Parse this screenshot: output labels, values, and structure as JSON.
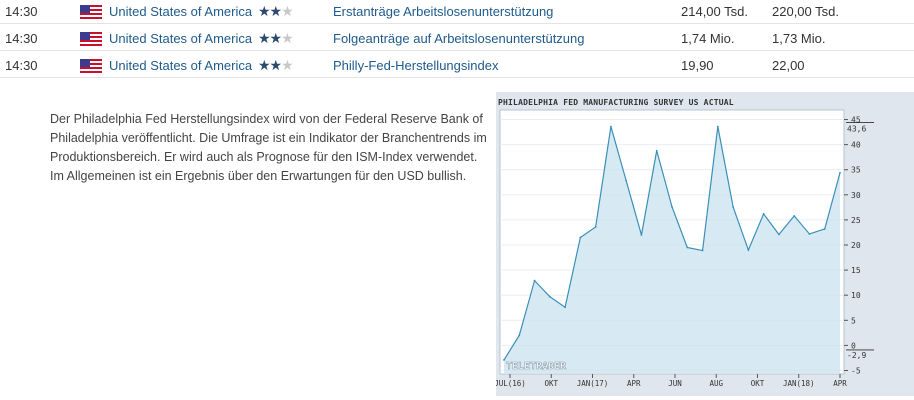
{
  "rows": [
    {
      "time": "14:30",
      "country": "United States of America",
      "stars_filled": 2,
      "stars_total": 3,
      "event": "Erstanträge Arbeitslosenunterstützung",
      "actual": "214,00 Tsd.",
      "forecast": "220,00 Tsd."
    },
    {
      "time": "14:30",
      "country": "United States of America",
      "stars_filled": 2,
      "stars_total": 3,
      "event": "Folgeanträge auf Arbeitslosenunterstützung",
      "actual": "1,74 Mio.",
      "forecast": "1,73 Mio."
    },
    {
      "time": "14:30",
      "country": "United States of America",
      "stars_filled": 2,
      "stars_total": 3,
      "event": "Philly-Fed-Herstellungsindex",
      "actual": "19,90",
      "forecast": "22,00"
    }
  ],
  "description": "Der Philadelphia Fed Herstellungsindex wird von der Federal Reserve Bank of Philadelphia veröffentlicht. Die Umfrage ist ein Indikator der Branchentrends im Produktionsbereich. Er wird auch als Prognose für den ISM-Index verwendet. Im Allgemeinen ist ein Ergebnis über den Erwartungen für den USD bullish.",
  "colors": {
    "link": "#1f5a8c",
    "star_on": "#2d4a6e",
    "star_off": "#c8c8c8",
    "chart_line": "#3a8fb8",
    "chart_fill": "#c9e3ef",
    "chart_frame_bg": "#dfe6ee"
  },
  "chart_data": {
    "type": "area",
    "title": "PHILADELPHIA FED MANUFACTURING SURVEY US ACTUAL",
    "watermark": "TELETRADER",
    "x_tick_labels": [
      "JUL(16)",
      "OKT",
      "JAN(17)",
      "APR",
      "JUN",
      "AUG",
      "OKT",
      "JAN(18)",
      "APR"
    ],
    "y_ticks": [
      -5,
      0,
      5,
      10,
      15,
      20,
      25,
      30,
      35,
      40,
      45
    ],
    "ylim": [
      -5.5,
      46.5
    ],
    "max_label": "43,6",
    "min_label": "-2,9",
    "values": [
      -2.9,
      2.0,
      12.9,
      9.7,
      7.6,
      21.5,
      23.6,
      43.6,
      32.8,
      22.0,
      38.8,
      27.6,
      19.5,
      18.9,
      43.6,
      27.6,
      19.0,
      26.2,
      22.1,
      25.8,
      22.2,
      23.2,
      34.4
    ]
  }
}
